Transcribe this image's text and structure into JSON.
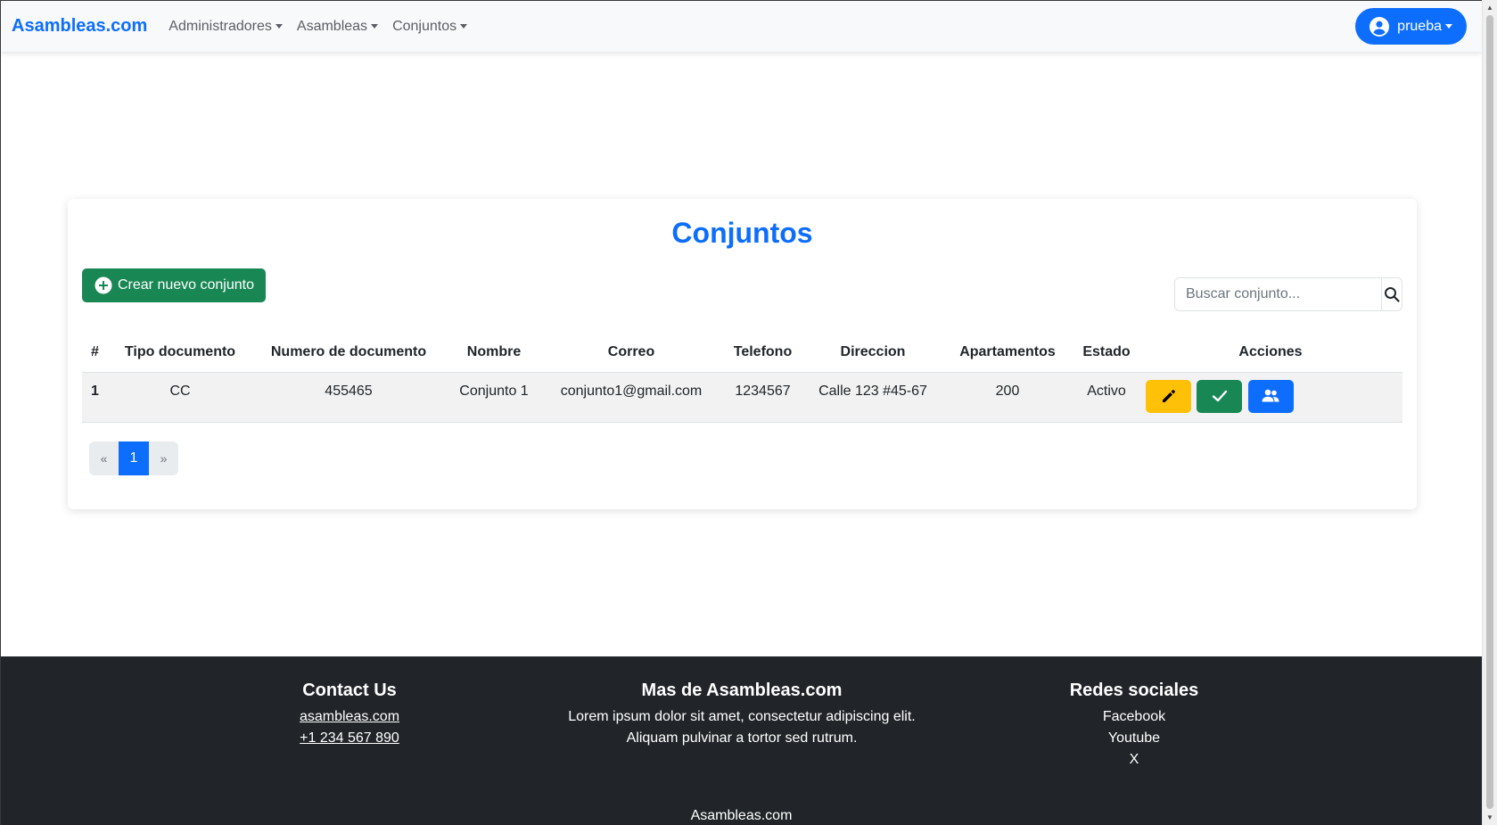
{
  "navbar": {
    "brand": "Asambleas.com",
    "menus": [
      {
        "label": "Administradores"
      },
      {
        "label": "Asambleas"
      },
      {
        "label": "Conjuntos"
      }
    ],
    "user": "prueba"
  },
  "page": {
    "title": "Conjuntos",
    "create_button": "Crear nuevo conjunto",
    "search_placeholder": "Buscar conjunto..."
  },
  "table": {
    "headers": [
      "#",
      "Tipo documento",
      "Numero de documento",
      "Nombre",
      "Correo",
      "Telefono",
      "Direccion",
      "Apartamentos",
      "Estado",
      "Acciones"
    ],
    "rows": [
      {
        "num": "1",
        "tipo": "CC",
        "numero": "455465",
        "nombre": "Conjunto 1",
        "correo": "conjunto1@gmail.com",
        "telefono": "1234567",
        "direccion": "Calle 123 #45-67",
        "apartamentos": "200",
        "estado": "Activo",
        "actions": [
          "pencil-icon",
          "check-icon",
          "users-icon"
        ]
      }
    ]
  },
  "pagination": {
    "prev": "«",
    "current": "1",
    "next": "»"
  },
  "footer": {
    "contact": {
      "title": "Contact Us",
      "website": "asambleas.com",
      "phone": "+1 234 567 890"
    },
    "mas": {
      "title": "Mas de Asambleas.com",
      "line1": "Lorem ipsum dolor sit amet, consectetur adipiscing elit.",
      "line2": "Aliquam pulvinar a tortor sed rutrum."
    },
    "redes": {
      "title": "Redes sociales",
      "links": [
        "Facebook",
        "Youtube",
        "X"
      ]
    },
    "bottom": "Asambleas.com"
  },
  "colors": {
    "primary": "#0d6efd",
    "success": "#198754",
    "warning": "#ffc107",
    "dark": "#212529",
    "light": "#f8f9fa"
  }
}
